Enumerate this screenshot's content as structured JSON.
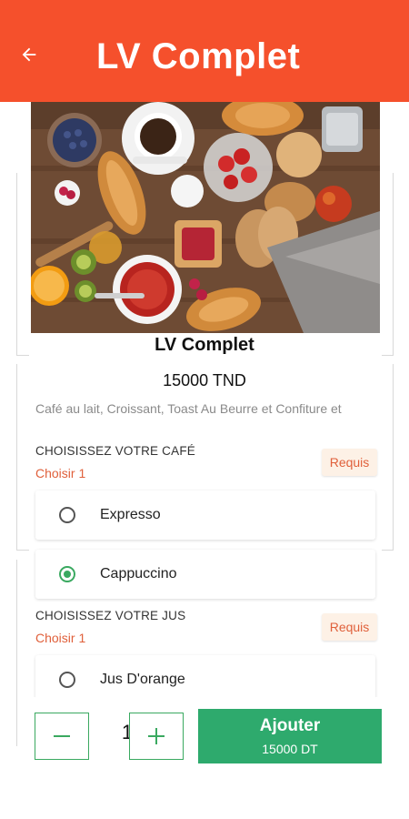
{
  "header": {
    "title": "LV Complet",
    "back_icon": "arrow-left-icon"
  },
  "colors": {
    "header_bg": "#f5502c",
    "accent_green": "#2eaa6d",
    "required_text": "#e0603b",
    "required_bg": "#fdf1e6"
  },
  "product": {
    "name": "LV Complet",
    "price": "15000 TND",
    "description": "Café au lait, Croissant, Toast Au Beurre et Confiture et"
  },
  "sections": [
    {
      "title": "CHOISISSEZ VOTRE CAFÉ",
      "subtitle": "Choisir 1",
      "required_label": "Requis",
      "options": [
        {
          "label": "Expresso",
          "selected": false
        },
        {
          "label": "Cappuccino",
          "selected": true
        }
      ]
    },
    {
      "title": "CHOISISSEZ VOTRE JUS",
      "subtitle": "Choisir 1",
      "required_label": "Requis",
      "options": [
        {
          "label": "Jus D'orange",
          "selected": false
        }
      ]
    }
  ],
  "cart": {
    "quantity": "1",
    "minus_icon": "minus-icon",
    "plus_icon": "plus-icon",
    "add_label": "Ajouter",
    "add_price": "15000 DT"
  }
}
